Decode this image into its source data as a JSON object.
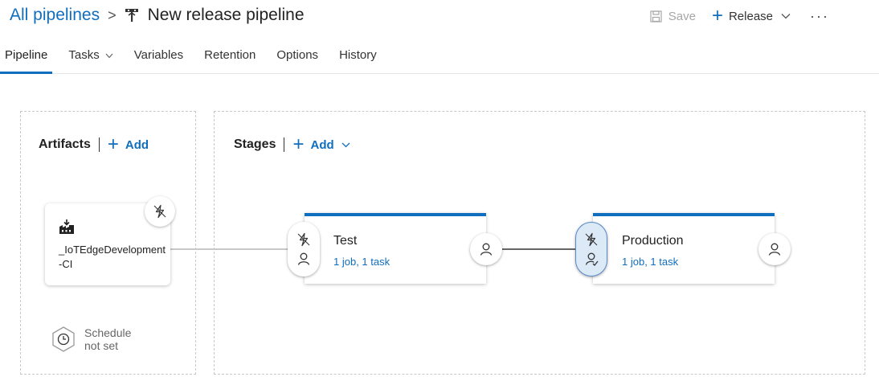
{
  "breadcrumb": {
    "root": "All pipelines",
    "separator": ">",
    "pipeline_icon": "release-pipeline-icon",
    "title": "New release pipeline"
  },
  "toolbar": {
    "save_label": "Save",
    "release_label": "Release",
    "more_label": "···"
  },
  "tabs": [
    {
      "label": "Pipeline",
      "active": true
    },
    {
      "label": "Tasks",
      "has_dropdown": true
    },
    {
      "label": "Variables"
    },
    {
      "label": "Retention"
    },
    {
      "label": "Options"
    },
    {
      "label": "History"
    }
  ],
  "artifacts": {
    "title": "Artifacts",
    "add_label": "Add",
    "artifact_name": "_IoTEdgeDevelopment-CI",
    "artifact_icon": "build-icon",
    "trigger_icon": "lightning-icon",
    "schedule_line1": "Schedule",
    "schedule_line2": "not set"
  },
  "stages": {
    "title": "Stages",
    "add_label": "Add",
    "items": [
      {
        "name": "Test",
        "info": "1 job, 1 task",
        "selected": false
      },
      {
        "name": "Production",
        "info": "1 job, 1 task",
        "selected": true
      }
    ]
  },
  "colors": {
    "accent": "#106ebe",
    "selected_fill": "#dce9f7"
  }
}
